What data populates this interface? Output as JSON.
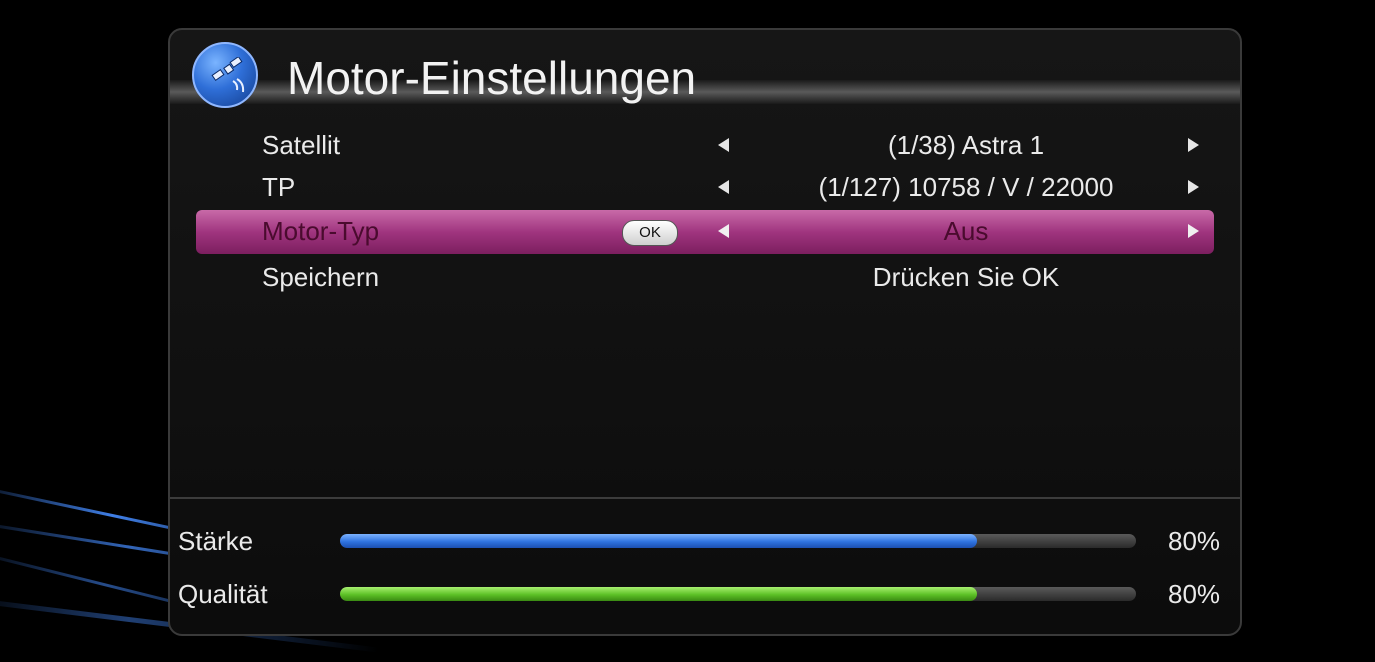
{
  "title": "Motor-Einstellungen",
  "icons": {
    "header": "satellite-icon"
  },
  "rows": [
    {
      "label": "Satellit",
      "value": "(1/38) Astra 1",
      "has_arrows": true
    },
    {
      "label": "TP",
      "value": "(1/127) 10758 / V / 22000",
      "has_arrows": true
    },
    {
      "label": "Motor-Typ",
      "value": "Aus",
      "has_arrows": true,
      "selected": true,
      "badge": "OK"
    },
    {
      "label": "Speichern",
      "value": "Drücken Sie OK",
      "has_arrows": false
    }
  ],
  "meters": {
    "strength": {
      "label": "Stärke",
      "percent_text": "80%",
      "level": 0.8,
      "color": "#2f73e0"
    },
    "quality": {
      "label": "Qualität",
      "percent_text": "80%",
      "level": 0.8,
      "color": "#5cc026"
    }
  },
  "colors": {
    "highlight": "#a0357f",
    "background": "#000000"
  }
}
